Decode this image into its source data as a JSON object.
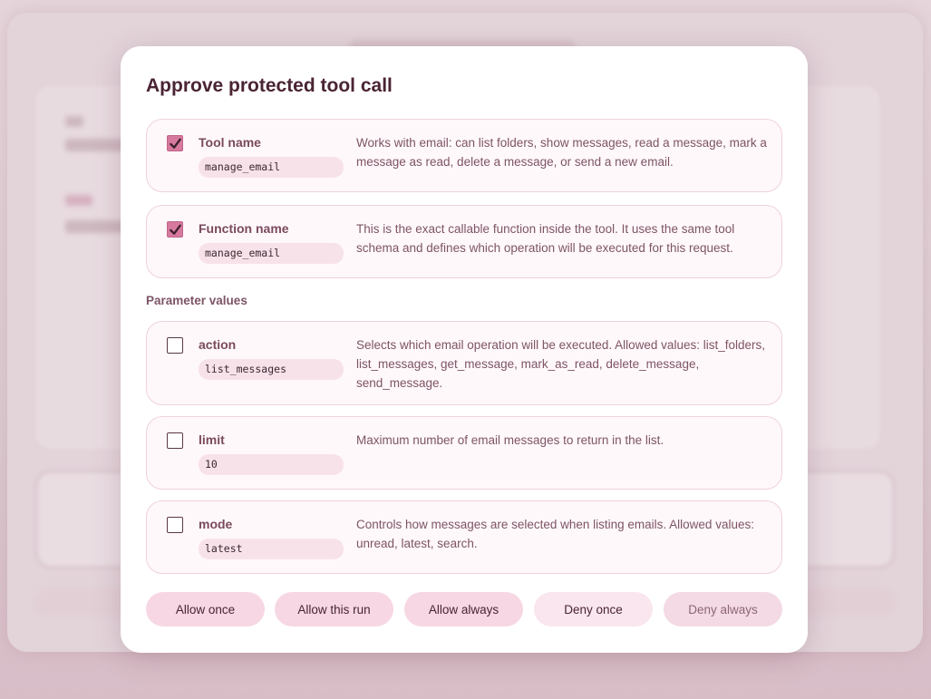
{
  "modal": {
    "title": "Approve protected tool call"
  },
  "tool": {
    "label": "Tool name",
    "value": "manage_email",
    "checked": true,
    "description": "Works with email: can list folders, show messages, read a message, mark a message as read, delete a message, or send a new email."
  },
  "function": {
    "label": "Function name",
    "value": "manage_email",
    "checked": true,
    "description": "This is the exact callable function inside the tool. It uses the same tool schema and defines which operation will be executed for this request."
  },
  "parameters": {
    "section_label": "Parameter values",
    "items": [
      {
        "label": "action",
        "value": "list_messages",
        "checked": false,
        "description": "Selects which email operation will be executed. Allowed values: list_folders, list_messages, get_message, mark_as_read, delete_message, send_message."
      },
      {
        "label": "limit",
        "value": "10",
        "checked": false,
        "description": "Maximum number of email messages to return in the list."
      },
      {
        "label": "mode",
        "value": "latest",
        "checked": false,
        "description": "Controls how messages are selected when listing emails. Allowed values: unread, latest, search."
      }
    ]
  },
  "buttons": {
    "allow_once": "Allow once",
    "allow_run": "Allow this run",
    "allow_always": "Allow always",
    "deny_once": "Deny once",
    "deny_always": "Deny always"
  },
  "colors": {
    "accent": "#d7799e",
    "title": "#4a2434",
    "card_border": "#efd2dc"
  }
}
